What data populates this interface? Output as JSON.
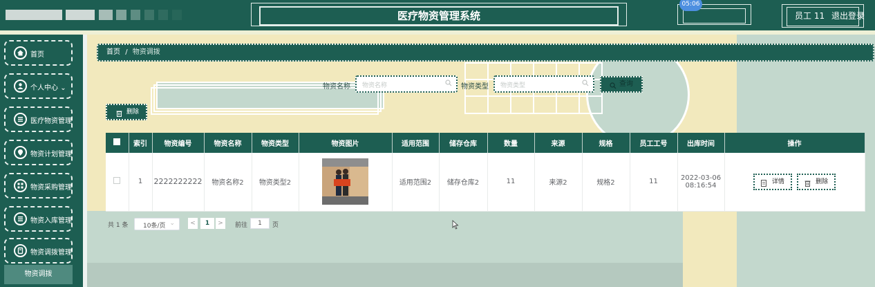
{
  "header": {
    "title": "医疗物资管理系统",
    "clock": "05:06",
    "user": "员工 11",
    "logout": "退出登录"
  },
  "sidebar": {
    "items": [
      {
        "label": "首页",
        "icon": "home-icon"
      },
      {
        "label": "个人中心",
        "icon": "user-icon"
      },
      {
        "label": "医疗物资管理",
        "icon": "list-icon"
      },
      {
        "label": "物资计划管理",
        "icon": "pin-icon"
      },
      {
        "label": "物资采购管理",
        "icon": "grid-icon"
      },
      {
        "label": "物资入库管理",
        "icon": "list-icon"
      },
      {
        "label": "物资调拨管理",
        "icon": "archive-icon"
      }
    ],
    "personal_arrow": "⌄",
    "active_sub": "物资调拨"
  },
  "breadcrumb": {
    "home": "首页",
    "sep": "/",
    "current": "物资调拨"
  },
  "search": {
    "name_label": "物资名称",
    "name_placeholder": "物资名称",
    "type_label": "物资类型",
    "type_placeholder": "物资类型",
    "button": "查询"
  },
  "toolbar": {
    "delete_label": "删除"
  },
  "table": {
    "headers": [
      "索引",
      "物资编号",
      "物资名称",
      "物资类型",
      "物资图片",
      "适用范围",
      "储存仓库",
      "数量",
      "来源",
      "规格",
      "员工工号",
      "出库时间",
      "操作"
    ],
    "rows": [
      {
        "index": "1",
        "code": "2222222222",
        "name": "物资名称2",
        "type": "物资类型2",
        "scope": "适用范围2",
        "warehouse": "储存仓库2",
        "quantity": "11",
        "source": "来源2",
        "spec": "规格2",
        "staff_no": "11",
        "time_date": "2022-03-06",
        "time_clock": "08:16:54",
        "detail_label": "详情",
        "delete_label": "删除"
      }
    ]
  },
  "pagination": {
    "total": "共 1 条",
    "page_size": "10条/页",
    "prev": "<",
    "current": "1",
    "next": ">",
    "goto": "前往",
    "goto_value": "1",
    "page_suffix": "页"
  },
  "colors": {
    "primary": "#1d5e52",
    "background": "#f2e9bd",
    "deco": "#c3d8cd"
  }
}
